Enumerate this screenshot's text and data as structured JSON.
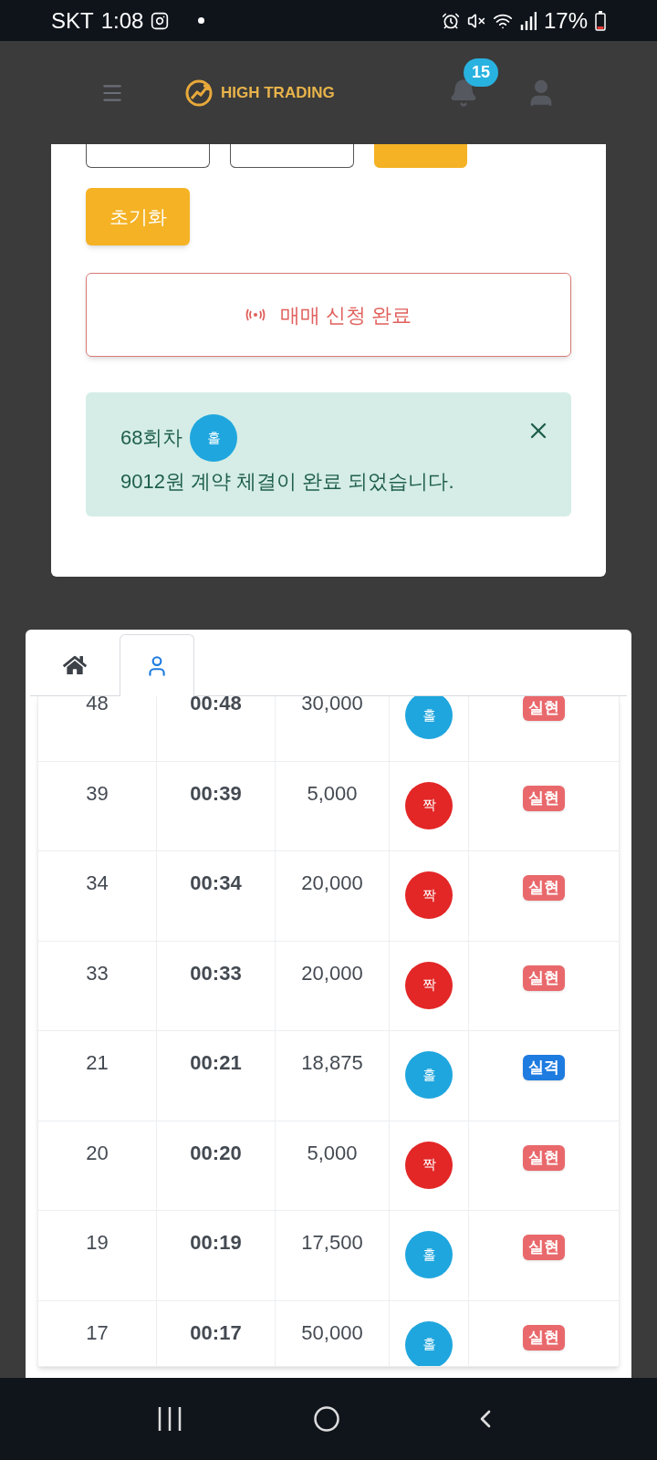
{
  "status_bar": {
    "carrier": "SKT",
    "time": "1:08",
    "battery": "17%"
  },
  "header": {
    "logo": "HIGH TRADING",
    "notifications": "15"
  },
  "form": {
    "reset_button": "초기화",
    "status_button": "매매 신청 완료"
  },
  "alert": {
    "round": "68회차",
    "pick": {
      "kind": "odd",
      "label": "홀"
    },
    "message": "9012원 계약 체결이 완료 되었습니다."
  },
  "tabs": [
    {
      "kind": "home",
      "selected": false
    },
    {
      "kind": "user",
      "selected": true
    }
  ],
  "rows": [
    {
      "round": "48",
      "time": "00:48",
      "amount": "30,000",
      "pick": {
        "kind": "odd",
        "label": "홀"
      },
      "result": {
        "kind": "win",
        "label": "실현"
      }
    },
    {
      "round": "39",
      "time": "00:39",
      "amount": "5,000",
      "pick": {
        "kind": "even",
        "label": "짝"
      },
      "result": {
        "kind": "win",
        "label": "실현"
      }
    },
    {
      "round": "34",
      "time": "00:34",
      "amount": "20,000",
      "pick": {
        "kind": "even",
        "label": "짝"
      },
      "result": {
        "kind": "win",
        "label": "실현"
      }
    },
    {
      "round": "33",
      "time": "00:33",
      "amount": "20,000",
      "pick": {
        "kind": "even",
        "label": "짝"
      },
      "result": {
        "kind": "win",
        "label": "실현"
      }
    },
    {
      "round": "21",
      "time": "00:21",
      "amount": "18,875",
      "pick": {
        "kind": "odd",
        "label": "홀"
      },
      "result": {
        "kind": "loss",
        "label": "실격"
      }
    },
    {
      "round": "20",
      "time": "00:20",
      "amount": "5,000",
      "pick": {
        "kind": "even",
        "label": "짝"
      },
      "result": {
        "kind": "win",
        "label": "실현"
      }
    },
    {
      "round": "19",
      "time": "00:19",
      "amount": "17,500",
      "pick": {
        "kind": "odd",
        "label": "홀"
      },
      "result": {
        "kind": "win",
        "label": "실현"
      }
    },
    {
      "round": "17",
      "time": "00:17",
      "amount": "50,000",
      "pick": {
        "kind": "odd",
        "label": "홀"
      },
      "result": {
        "kind": "win",
        "label": "실현"
      }
    }
  ]
}
